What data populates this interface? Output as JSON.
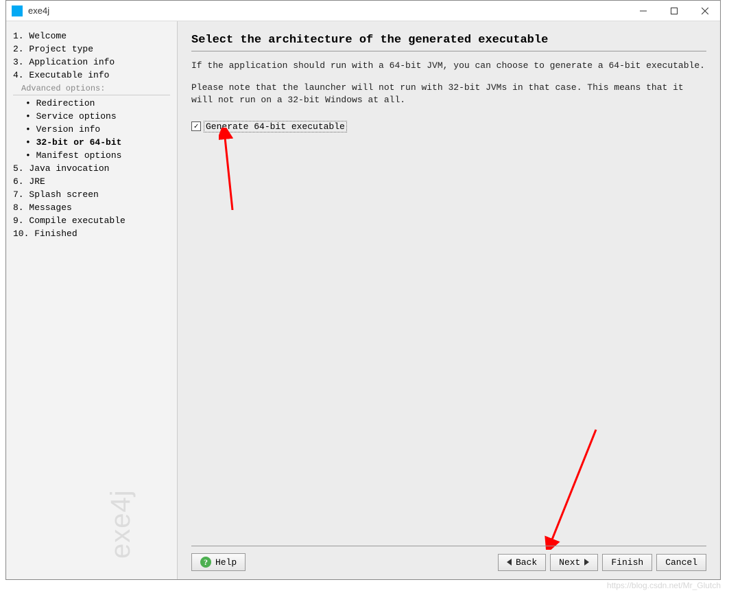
{
  "window": {
    "title": "exe4j",
    "watermark": "exe4j"
  },
  "sidebar": {
    "items": [
      {
        "label": "1. Welcome"
      },
      {
        "label": "2. Project type"
      },
      {
        "label": "3. Application info"
      },
      {
        "label": "4. Executable info"
      }
    ],
    "advanced_header": "Advanced options:",
    "advanced_items": [
      {
        "label": "Redirection"
      },
      {
        "label": "Service options"
      },
      {
        "label": "Version info"
      },
      {
        "label": "32-bit or 64-bit",
        "active": true
      },
      {
        "label": "Manifest options"
      }
    ],
    "items_after": [
      {
        "label": "5. Java invocation"
      },
      {
        "label": "6. JRE"
      },
      {
        "label": "7. Splash screen"
      },
      {
        "label": "8. Messages"
      },
      {
        "label": "9. Compile executable"
      },
      {
        "label": "10. Finished"
      }
    ]
  },
  "main": {
    "heading": "Select the architecture of the generated executable",
    "paragraph1": "If the application should run with a 64-bit JVM, you can choose to generate a 64-bit executable.",
    "paragraph2": "Please note that the launcher will not run with 32-bit JVMs in that case. This means that it will not run on a 32-bit Windows at all.",
    "checkbox_label": "Generate 64-bit executable",
    "checkbox_checked": true
  },
  "buttons": {
    "help": "Help",
    "back": "Back",
    "next": "Next",
    "finish": "Finish",
    "cancel": "Cancel"
  },
  "footer_watermark": "https://blog.csdn.net/Mr_Glutch"
}
